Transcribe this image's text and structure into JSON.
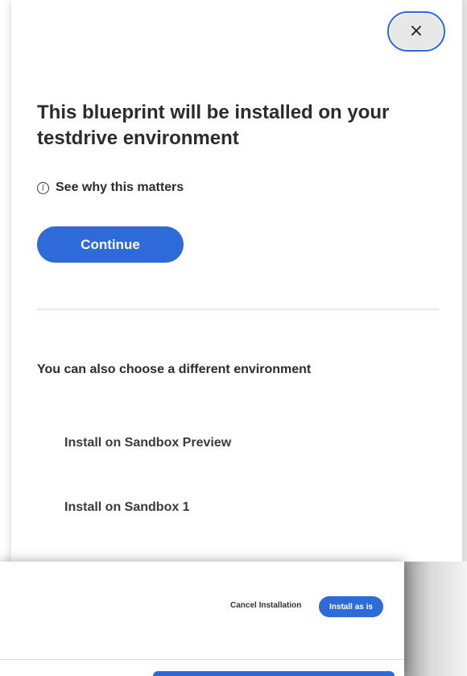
{
  "modal": {
    "close_icon": "×",
    "title": "This blueprint will be installed on your testdrive environment",
    "info_link": "See why this matters",
    "info_icon": "i",
    "continue_label": "Continue",
    "alt_env_heading": "You can also choose a different environment",
    "env_options": [
      "Install on Sandbox Preview",
      "Install on Sandbox 1"
    ]
  },
  "background_dialog": {
    "cancel_label": "Cancel Installation",
    "install_label": "Install as is"
  },
  "colors": {
    "accent": "#2f6bd8",
    "close_button_bg": "#e8e8e8",
    "divider": "#e6e8ef"
  },
  "icons": {
    "close": "close-icon",
    "info": "info-icon"
  }
}
